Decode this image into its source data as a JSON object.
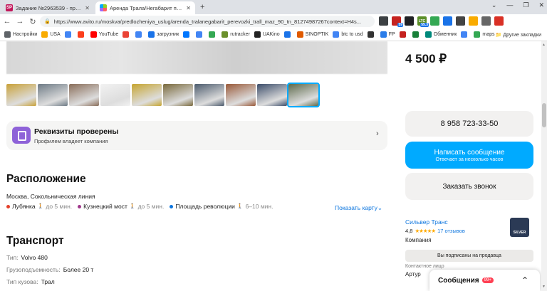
{
  "browser": {
    "tabs": [
      {
        "title": "Задание №2963539 - просмотр з",
        "icon": "sp-icon",
        "active": false
      },
      {
        "title": "Аренда Трала/Негабарит перевоз",
        "icon": "avito-icon",
        "active": true
      }
    ],
    "new_tab": "+",
    "url": "https://www.avito.ru/moskva/predlozheniya_uslug/arenda_tralanegabarit_perevozki_trall_maz_90_tn_81274987267context=H4s...",
    "extensions": [
      {
        "name": "ext-icon-1",
        "color": "#3c4043",
        "badge": ""
      },
      {
        "name": "ext-icon-2",
        "color": "#c5221f",
        "badge": "59"
      },
      {
        "name": "ext-icon-3",
        "color": "#202124",
        "badge": ""
      },
      {
        "name": "ltc-icon",
        "color": "#5b8f29",
        "badge": "55.3"
      },
      {
        "name": "ext-icon-5",
        "color": "#34a853",
        "badge": ""
      },
      {
        "name": "ext-icon-6",
        "color": "#1a73e8",
        "badge": ""
      },
      {
        "name": "ext-icon-7",
        "color": "#444",
        "badge": ""
      },
      {
        "name": "ext-icon-8",
        "color": "#f9ab00",
        "badge": ""
      },
      {
        "name": "ext-icon-9",
        "color": "#666",
        "badge": ""
      },
      {
        "name": "ext-icon-10",
        "color": "#d93025",
        "badge": ""
      }
    ],
    "ltc_label": "LTC",
    "bookmarks": [
      {
        "label": "Настройки",
        "icon": "gear-icon",
        "color": "#5f6368"
      },
      {
        "label": "USA",
        "icon": "folder-icon",
        "color": "#f9ab00"
      },
      {
        "label": "",
        "icon": "google-icon",
        "color": "#4285f4"
      },
      {
        "label": "",
        "icon": "yandex-icon",
        "color": "#fc3f1d"
      },
      {
        "label": "YouTube",
        "icon": "youtube-icon",
        "color": "#ff0000"
      },
      {
        "label": "",
        "icon": "gmail-icon",
        "color": "#ea4335"
      },
      {
        "label": "",
        "icon": "google-icon",
        "color": "#4285f4"
      },
      {
        "label": "загрузник",
        "icon": "download-icon",
        "color": "#1a73e8"
      },
      {
        "label": "",
        "icon": "vk-icon",
        "color": "#0077ff"
      },
      {
        "label": "",
        "icon": "google-icon",
        "color": "#4285f4"
      },
      {
        "label": "",
        "icon": "puzzle-icon",
        "color": "#34a853"
      },
      {
        "label": "rutracker",
        "icon": "rutracker-icon",
        "color": "#6a8f2b"
      },
      {
        "label": "UAKino",
        "icon": "uakino-icon",
        "color": "#222"
      },
      {
        "label": "",
        "icon": "folder-icon",
        "color": "#1a73e8"
      },
      {
        "label": "SINOPTIK",
        "icon": "sinoptik-icon",
        "color": "#e05a00"
      },
      {
        "label": "btc to usd",
        "icon": "google-icon",
        "color": "#4285f4"
      },
      {
        "label": "",
        "icon": "ext-icon",
        "color": "#333"
      },
      {
        "label": "FP",
        "icon": "fp-icon",
        "color": "#2b7de9"
      },
      {
        "label": "",
        "icon": "ext-icon",
        "color": "#c5221f"
      },
      {
        "label": "",
        "icon": "ext-icon",
        "color": "#188038"
      },
      {
        "label": "Обменник",
        "icon": "exchange-icon",
        "color": "#00897b"
      },
      {
        "label": "",
        "icon": "google-icon",
        "color": "#4285f4"
      },
      {
        "label": "maps",
        "icon": "maps-icon",
        "color": "#34a853"
      }
    ],
    "other_bookmarks": "Другие закладки"
  },
  "listing": {
    "thumbnails": [
      {
        "color": "#c9a23a",
        "selected": false
      },
      {
        "color": "#6e7b86",
        "selected": false
      },
      {
        "color": "#8a6e5a",
        "selected": false
      },
      {
        "color": "#f2f2f2",
        "selected": false
      },
      {
        "color": "#c6a531",
        "selected": false
      },
      {
        "color": "#7a6a3d",
        "selected": false
      },
      {
        "color": "#4d5c6e",
        "selected": false
      },
      {
        "color": "#9a5a3a",
        "selected": false
      },
      {
        "color": "#3d4e6b",
        "selected": false
      },
      {
        "color": "#5e6b4c",
        "selected": true
      }
    ],
    "verified_title": "Реквизиты проверены",
    "verified_sub": "Профилем владеет компания",
    "location": {
      "heading": "Расположение",
      "address": "Москва, Сокольническая линия",
      "metro": [
        {
          "name": "Лубянка",
          "time": "до 5 мин.",
          "color": "#e4402a"
        },
        {
          "name": "Кузнецкий мост",
          "time": "до 5 мин.",
          "color": "#a0378b"
        },
        {
          "name": "Площадь революции",
          "time": "6–10 мин.",
          "color": "#0a74de"
        }
      ],
      "show_map": "Показать карту"
    },
    "transport": {
      "heading": "Транспорт",
      "params": [
        {
          "key": "Тип:",
          "value": "Volvo 480"
        },
        {
          "key": "Грузоподъемность:",
          "value": "Более 20 т"
        },
        {
          "key": "Тип кузова:",
          "value": "Трал"
        }
      ]
    }
  },
  "sidebar": {
    "price": "4 500 ₽",
    "phone": "8 958 723-33-50",
    "write_msg": "Написать сообщение",
    "reply_time": "Отвечает за несколько часов",
    "order_call": "Заказать звонок",
    "seller": {
      "name": "Сильвер Транс",
      "rating": "4,8",
      "stars": "★★★★★",
      "reviews": "17 отзывов",
      "type": "Компания",
      "logo_text": "SILVER"
    },
    "subscribed": "Вы подписаны на продавца",
    "contact_label": "Контактное лицо",
    "contact_name": "Артур"
  },
  "messages": {
    "label": "Сообщения",
    "count": "99+"
  }
}
